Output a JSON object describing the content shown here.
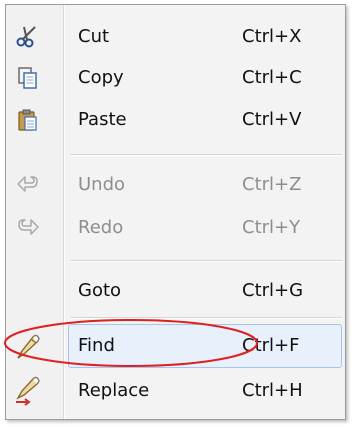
{
  "menu": {
    "items": [
      {
        "label": "Cut",
        "shortcut": "Ctrl+X",
        "icon": "scissors-icon",
        "enabled": true
      },
      {
        "label": "Copy",
        "shortcut": "Ctrl+C",
        "icon": "copy-icon",
        "enabled": true
      },
      {
        "label": "Paste",
        "shortcut": "Ctrl+V",
        "icon": "paste-icon",
        "enabled": true
      },
      {
        "label": "Undo",
        "shortcut": "Ctrl+Z",
        "icon": "undo-icon",
        "enabled": false
      },
      {
        "label": "Redo",
        "shortcut": "Ctrl+Y",
        "icon": "redo-icon",
        "enabled": false
      },
      {
        "label": "Goto",
        "shortcut": "Ctrl+G",
        "icon": "",
        "enabled": true
      },
      {
        "label": "Find",
        "shortcut": "Ctrl+F",
        "icon": "find-icon",
        "enabled": true,
        "highlighted": true
      },
      {
        "label": "Replace",
        "shortcut": "Ctrl+H",
        "icon": "replace-icon",
        "enabled": true
      }
    ]
  },
  "colors": {
    "highlight_bg": "#e8f0fb",
    "highlight_border": "#a7c4ec",
    "annotation_circle": "#e02020",
    "disabled_text": "#8e8e8e"
  }
}
